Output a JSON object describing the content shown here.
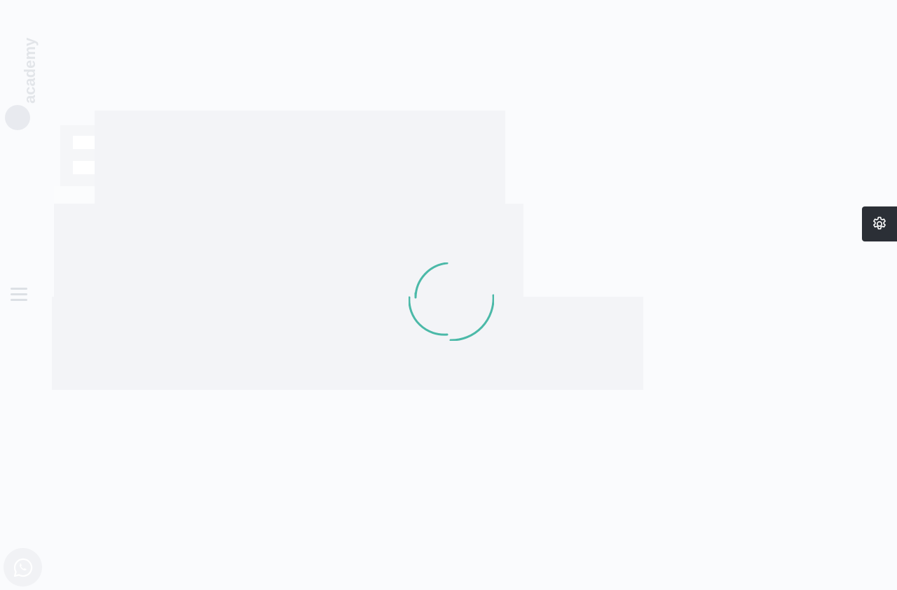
{
  "brand": {
    "name": "academy",
    "logo_icon": "brand-logo-icon"
  },
  "sidebar": {
    "menu_icon": "hamburger-menu-icon"
  },
  "loader": {
    "icon": "loading-spinner-icon",
    "color": "#4bb9a8"
  },
  "settings": {
    "icon": "gear-icon",
    "background": "#2b2f36"
  },
  "chat": {
    "icon": "whatsapp-icon"
  }
}
